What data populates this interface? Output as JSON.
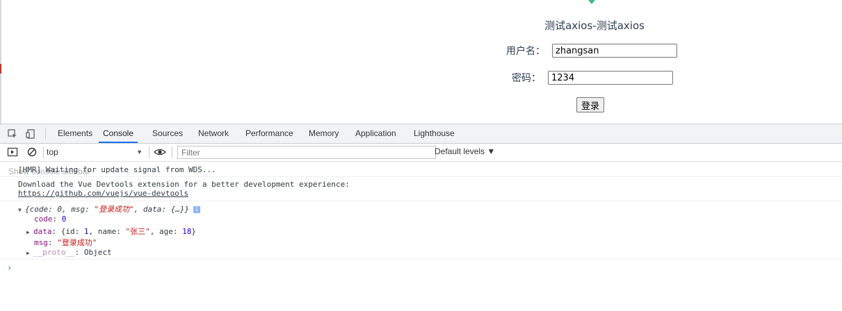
{
  "page": {
    "title": "测试axios-测试axios",
    "username_label": "用户名：",
    "username_value": "zhangsan",
    "password_label": "密码：",
    "password_value": "1234",
    "login_button": "登录"
  },
  "devtools": {
    "tabs": [
      "Elements",
      "Console",
      "Sources",
      "Network",
      "Performance",
      "Memory",
      "Application",
      "Lighthouse"
    ],
    "active_tab": "Console",
    "toolbar": {
      "context": "top",
      "filter_placeholder": "Filter",
      "levels": "Default levels ▼"
    },
    "console": {
      "ghost_hint": "Show console sidebar",
      "hmr": "[HMR] Waiting for update signal from WDS...",
      "devtools_msg": "Download the Vue Devtools extension for a better development experience:",
      "devtools_link": "https://github.com/vuejs/vue-devtools",
      "obj_summary_prefix": "{code: 0, msg: ",
      "obj_summary_msg": "\"登录成功\"",
      "obj_summary_suffix": ", data: {…}}",
      "code_key": "code",
      "code_val": "0",
      "data_key": "data",
      "data_prefix": ": {id: ",
      "data_id": "1",
      "data_mid": ", name: ",
      "data_name": "\"张三\"",
      "data_mid2": ", age: ",
      "data_age": "18",
      "data_suffix": "}",
      "msg_key": "msg",
      "msg_val": "\"登录成功\"",
      "proto_key": "__proto__",
      "proto_val": ": Object",
      "prompt": "›"
    }
  }
}
